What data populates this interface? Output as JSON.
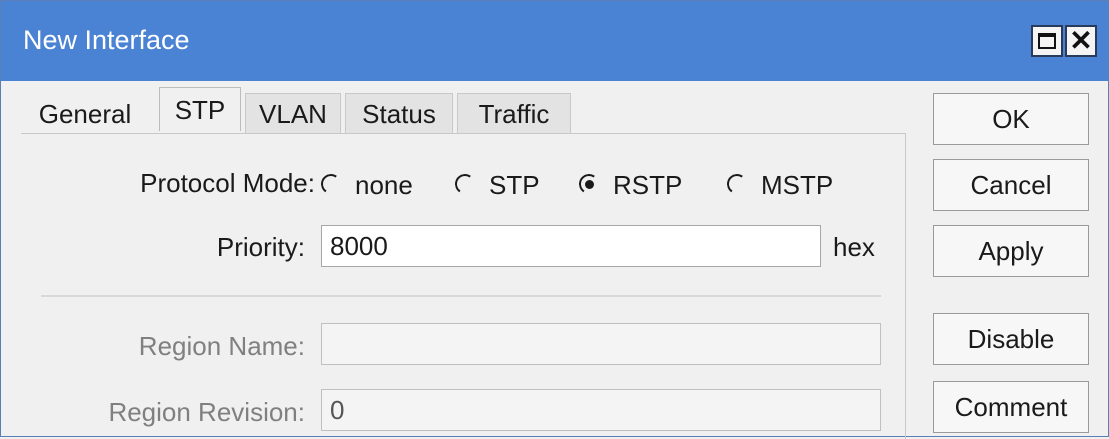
{
  "window": {
    "title": "New Interface"
  },
  "tabs": [
    {
      "label": "General",
      "active": false
    },
    {
      "label": "STP",
      "active": true
    },
    {
      "label": "VLAN",
      "active": false
    },
    {
      "label": "Status",
      "active": false
    },
    {
      "label": "Traffic",
      "active": false
    }
  ],
  "stp": {
    "protocol_mode": {
      "label": "Protocol Mode:",
      "options": [
        "none",
        "STP",
        "RSTP",
        "MSTP"
      ],
      "selected": "RSTP"
    },
    "priority": {
      "label": "Priority:",
      "value": "8000",
      "suffix": "hex"
    },
    "region_name": {
      "label": "Region Name:",
      "value": ""
    },
    "region_revision": {
      "label": "Region Revision:",
      "value": "0"
    }
  },
  "buttons": {
    "ok": "OK",
    "cancel": "Cancel",
    "apply": "Apply",
    "disable": "Disable",
    "comment": "Comment"
  },
  "icons": {
    "maximize": "maximize-icon",
    "close": "close-icon"
  },
  "colors": {
    "titlebar": "#4a82d4",
    "window_bg": "#f0f0f0"
  }
}
